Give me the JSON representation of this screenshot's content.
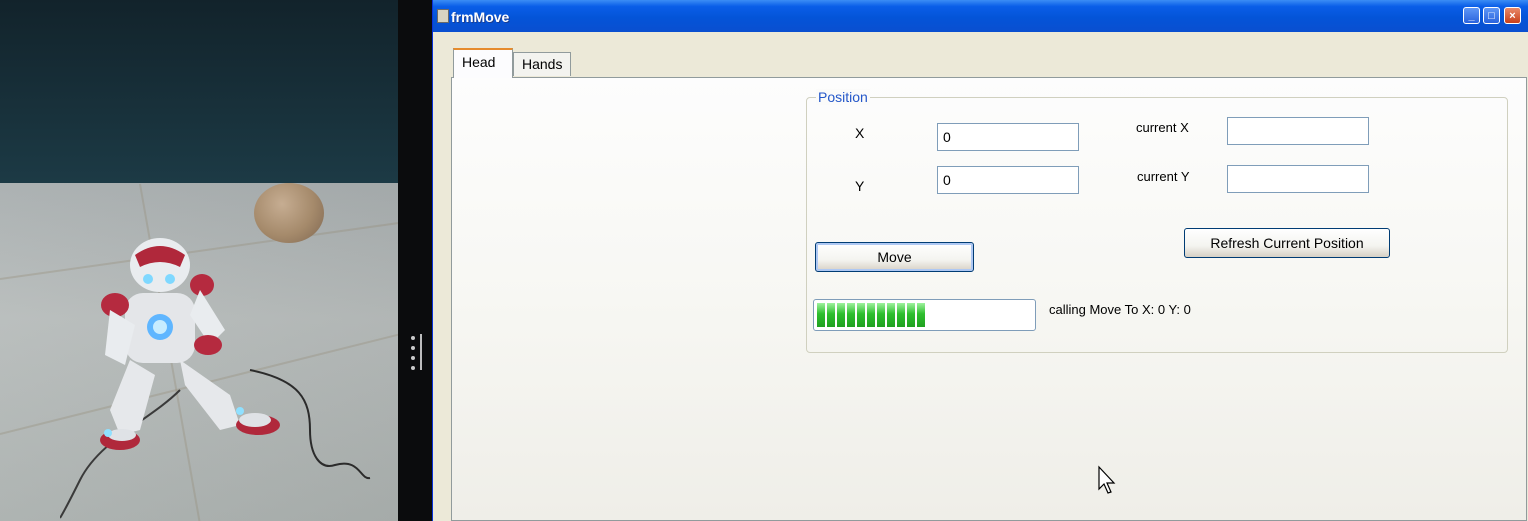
{
  "window": {
    "title": "frmMove"
  },
  "tabs": [
    {
      "label": "Head",
      "selected": true
    },
    {
      "label": "Hands",
      "selected": false
    }
  ],
  "position_group": {
    "legend": "Position",
    "x_label": "X",
    "y_label": "Y",
    "x_value": "0",
    "y_value": "0",
    "current_x_label": "current X",
    "current_y_label": "current Y",
    "current_x_value": "",
    "current_y_value": "",
    "move_button": "Move",
    "refresh_button": "Refresh Current Position",
    "progress_percent": 50,
    "status_text": "calling Move To X: 0 Y: 0"
  },
  "icons": {
    "title_icon": "form-icon",
    "minimize": "minimize-icon",
    "maximize": "maximize-icon",
    "close": "close-icon",
    "cursor": "mouse-pointer-icon"
  },
  "colors": {
    "titlebar": "#0454d8",
    "legend": "#2457c9",
    "progress": "#2fbf2f"
  }
}
